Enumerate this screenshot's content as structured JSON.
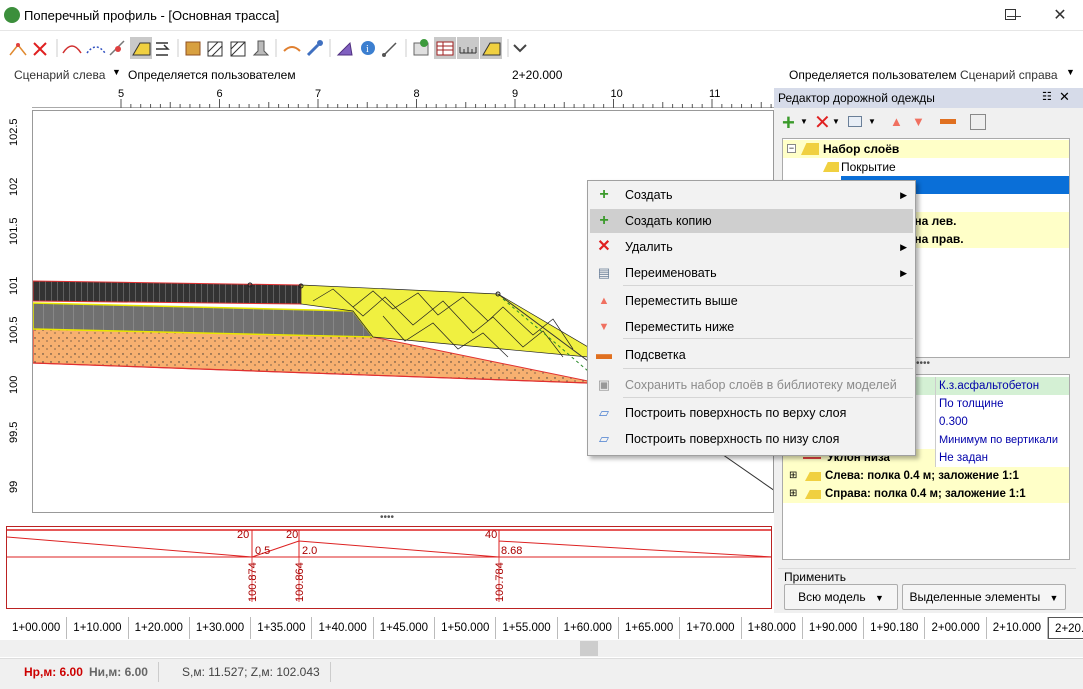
{
  "window": {
    "title": "Поперечный профиль - [Основная трасса]"
  },
  "scenario": {
    "left_label": "Сценарий слева",
    "left_value": "Определяется пользователем",
    "center": "2+20.000",
    "right_value": "Определяется пользователем",
    "right_label": "Сценарий справа"
  },
  "ruler": {
    "h_ticks": [
      "5",
      "6",
      "7",
      "8",
      "9",
      "10",
      "11"
    ],
    "v_ticks": [
      "102.5",
      "102",
      "101.5",
      "101",
      "100.5",
      "100",
      "99.5",
      "99"
    ]
  },
  "profile": {
    "top_numbers": [
      "20",
      "20",
      "40"
    ],
    "bottom_numbers": [
      "0.5",
      "2.0",
      "8.68"
    ],
    "elevations": [
      "100.874",
      "100.864",
      "100.784"
    ]
  },
  "stations": [
    "1+00.000",
    "1+10.000",
    "1+20.000",
    "1+30.000",
    "1+35.000",
    "1+40.000",
    "1+45.000",
    "1+50.000",
    "1+55.000",
    "1+60.000",
    "1+65.000",
    "1+70.000",
    "1+80.000",
    "1+90.000",
    "1+90.180",
    "2+00.000",
    "2+10.000",
    "2+20.000",
    "2+"
  ],
  "current_station": "2+20.000",
  "status": {
    "hr": "Hр,м: 6.00",
    "hi": "Hи,м: 6.00",
    "coords": "S,м: 11.527;  Z,м: 102.043"
  },
  "panel": {
    "title": "Редактор дорожной одежды",
    "tree": [
      {
        "label": "Набор слоёв",
        "bold": true
      },
      {
        "label": "Покрытие",
        "bold": false
      },
      {
        "label": "",
        "bold": false,
        "selected": true
      },
      {
        "label": "ий",
        "bold": false
      },
      {
        "label": "ина лев.",
        "bold": true
      },
      {
        "label": "ина прав.",
        "bold": true
      }
    ],
    "props": [
      {
        "name": "",
        "value": "К.з.асфальтобетон"
      },
      {
        "name": "",
        "value": "По толщине"
      },
      {
        "name": "",
        "value": "0.300"
      },
      {
        "name": "",
        "value": "Минимум по вертикали"
      },
      {
        "name": "Уклон низа",
        "value": "Не задан"
      },
      {
        "name": "Слева: полка 0.4 м; заложение 1:1",
        "value": ""
      },
      {
        "name": "Справа: полка 0.4 м; заложение 1:1",
        "value": ""
      }
    ],
    "apply_label": "Применить",
    "btn_all": "Всю модель",
    "btn_selected": "Выделенные элементы"
  },
  "menu": [
    {
      "label": "Создать",
      "icon": "plus-icon",
      "color": "#3a9a2a",
      "submenu": true,
      "highlighted": false,
      "disabled": false
    },
    {
      "label": "Создать копию",
      "icon": "plus-icon",
      "color": "#3a9a2a",
      "submenu": false,
      "highlighted": true,
      "disabled": false
    },
    {
      "label": "Удалить",
      "icon": "delete-icon",
      "color": "#e02020",
      "submenu": true,
      "highlighted": false,
      "disabled": false
    },
    {
      "label": "Переименовать",
      "icon": "rename-icon",
      "color": "#6a7f98",
      "submenu": true,
      "highlighted": false,
      "disabled": false
    },
    {
      "label": "Переместить выше",
      "icon": "arrow-up-icon",
      "color": "#f07060",
      "submenu": false,
      "highlighted": false,
      "disabled": false
    },
    {
      "label": "Переместить ниже",
      "icon": "arrow-down-icon",
      "color": "#f07060",
      "submenu": false,
      "highlighted": false,
      "disabled": false
    },
    {
      "label": "Подсветка",
      "icon": "highlight-icon",
      "color": "#e07020",
      "submenu": false,
      "highlighted": false,
      "disabled": false
    },
    {
      "label": "Сохранить набор слоёв в библиотеку моделей",
      "icon": "save-library-icon",
      "color": "#999999",
      "submenu": false,
      "highlighted": false,
      "disabled": true
    },
    {
      "label": "Построить поверхность по верху слоя",
      "icon": "surface-top-icon",
      "color": "#4a7fd0",
      "submenu": false,
      "highlighted": false,
      "disabled": false
    },
    {
      "label": "Построить поверхность по низу слоя",
      "icon": "surface-bottom-icon",
      "color": "#4a7fd0",
      "submenu": false,
      "highlighted": false,
      "disabled": false
    }
  ]
}
